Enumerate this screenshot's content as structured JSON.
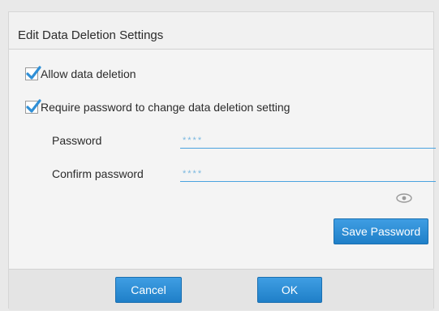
{
  "dialog": {
    "title": "Edit Data Deletion Settings",
    "allow_deletion": {
      "label": "Allow data deletion",
      "checked": true
    },
    "require_password": {
      "label": "Require password to change data deletion setting",
      "checked": true
    },
    "password": {
      "label": "Password",
      "value": "****"
    },
    "confirm_password": {
      "label": "Confirm password",
      "value": "****"
    },
    "eye_icon": "eye-icon",
    "save_password_label": "Save Password",
    "cancel_label": "Cancel",
    "ok_label": "OK"
  },
  "colors": {
    "accent": "#2b8ad6",
    "input_underline": "#4aa3df",
    "checkbox_check": "#2f8fd6"
  }
}
